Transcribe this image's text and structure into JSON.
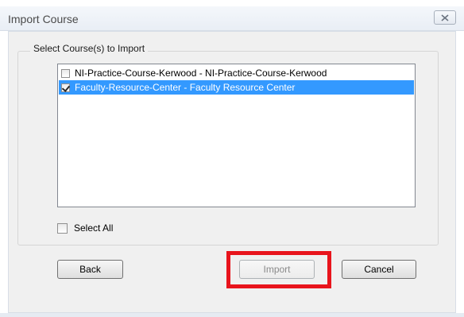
{
  "window": {
    "title": "Import Course",
    "close_icon": "close-icon"
  },
  "group": {
    "legend": "Select Course(s) to Import"
  },
  "courses": [
    {
      "label": "NI-Practice-Course-Kerwood - NI-Practice-Course-Kerwood",
      "checked": false,
      "selected": false
    },
    {
      "label": "Faculty-Resource-Center - Faculty Resource Center",
      "checked": true,
      "selected": true
    }
  ],
  "select_all": {
    "label": "Select All",
    "checked": false
  },
  "buttons": {
    "back": "Back",
    "import": "Import",
    "cancel": "Cancel"
  },
  "colors": {
    "selection": "#3399ff",
    "highlight": "#e8141c"
  }
}
